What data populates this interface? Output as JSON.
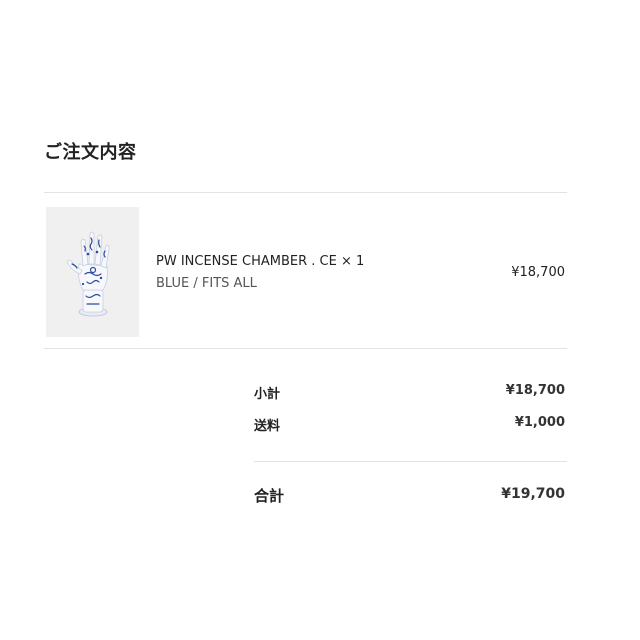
{
  "order": {
    "title": "ご注文内容"
  },
  "item": {
    "image_icon": "porcelain-hand-incense-chamber",
    "name": "PW INCENSE CHAMBER . CE × 1",
    "variant": "BLUE / FITS ALL",
    "price": "¥18,700"
  },
  "summary": {
    "subtotal_label": "小計",
    "subtotal_value": "¥18,700",
    "shipping_label": "送料",
    "shipping_value": "¥1,000",
    "total_label": "合計",
    "total_value": "¥19,700"
  },
  "colors": {
    "text": "#222222",
    "muted": "#555555",
    "divider": "#e3e3e3",
    "thumb_bg": "#f0f0f0",
    "porcelain_blue": "#2b4aa0"
  }
}
